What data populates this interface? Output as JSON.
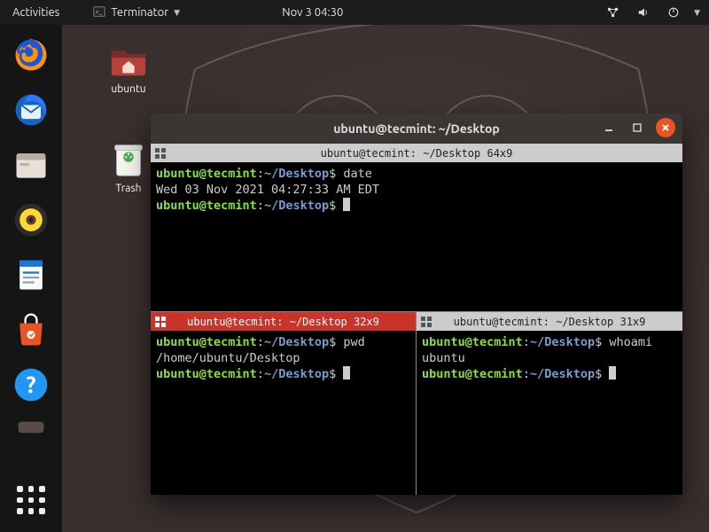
{
  "top_panel": {
    "activities": "Activities",
    "app_menu": "Terminator",
    "clock": "Nov 3  04:30"
  },
  "desktop_icons": {
    "home_label": "ubuntu",
    "trash_label": "Trash"
  },
  "window": {
    "title": "ubuntu@tecmint: ~/Desktop"
  },
  "panes": {
    "top": {
      "header": "ubuntu@tecmint: ~/Desktop 64x9",
      "prompt_user": "ubuntu@tecmint",
      "prompt_path": "~/Desktop",
      "cmd1": "date",
      "out1": "Wed 03 Nov 2021 04:27:33 AM EDT"
    },
    "bl": {
      "header": "ubuntu@tecmint: ~/Desktop 32x9",
      "prompt_user": "ubuntu@tecmint",
      "prompt_path": "~/Desktop",
      "cmd": "pwd",
      "out": "/home/ubuntu/Desktop"
    },
    "br": {
      "header": "ubuntu@tecmint: ~/Desktop 31x9",
      "prompt_user": "ubuntu@tecmint",
      "prompt_path": "~/Desktop",
      "cmd": "whoami",
      "out": "ubuntu"
    }
  }
}
